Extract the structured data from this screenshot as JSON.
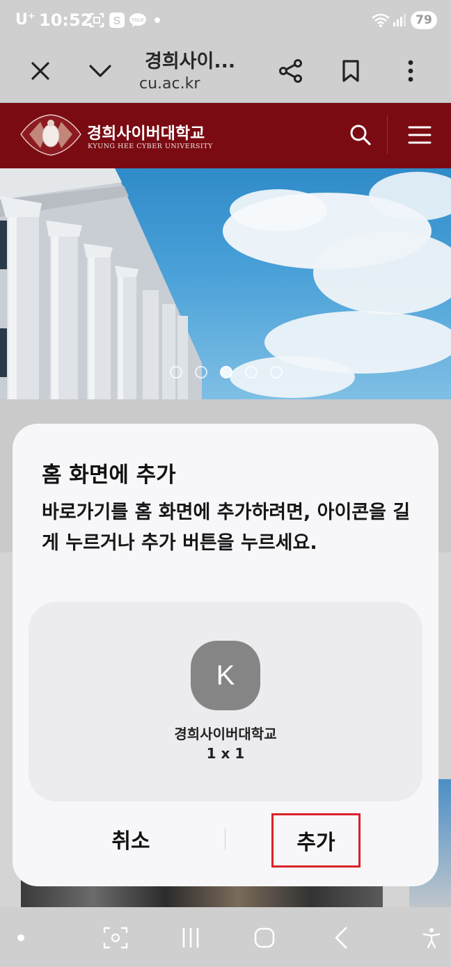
{
  "status_bar": {
    "carrier": "U",
    "carrier_sup": "+",
    "time": "10:52",
    "icons": [
      "screenshot-icon",
      "s-app-icon",
      "talk-icon",
      "wifi-icon",
      "signal-icon"
    ],
    "battery": "79"
  },
  "toolbar": {
    "title": "경희사이...",
    "url": "cu.ac.kr",
    "icons": [
      "close-icon",
      "chevron-down-icon",
      "share-icon",
      "bookmark-icon",
      "more-icon"
    ]
  },
  "site": {
    "name_ko": "경희사이버대학교",
    "name_en": "KYUNG HEE CYBER UNIVERSITY",
    "brand_color": "#7a0b12"
  },
  "carousel": {
    "slide_count": 5,
    "active_index": 2
  },
  "dialog": {
    "title": "홈 화면에 추가",
    "message": "바로가기를 홈 화면에 추가하려면, 아이콘을 길게 누르거나 추가 버튼을 누르세요.",
    "app_icon_letter": "K",
    "app_name": "경희사이버대학교",
    "app_size": "1 x 1",
    "cancel_label": "취소",
    "add_label": "추가",
    "highlight_color": "#d9212a"
  },
  "navbar": {
    "icons": [
      "dot-icon",
      "capture-icon",
      "recents-icon",
      "home-icon",
      "back-icon",
      "accessibility-icon"
    ]
  }
}
